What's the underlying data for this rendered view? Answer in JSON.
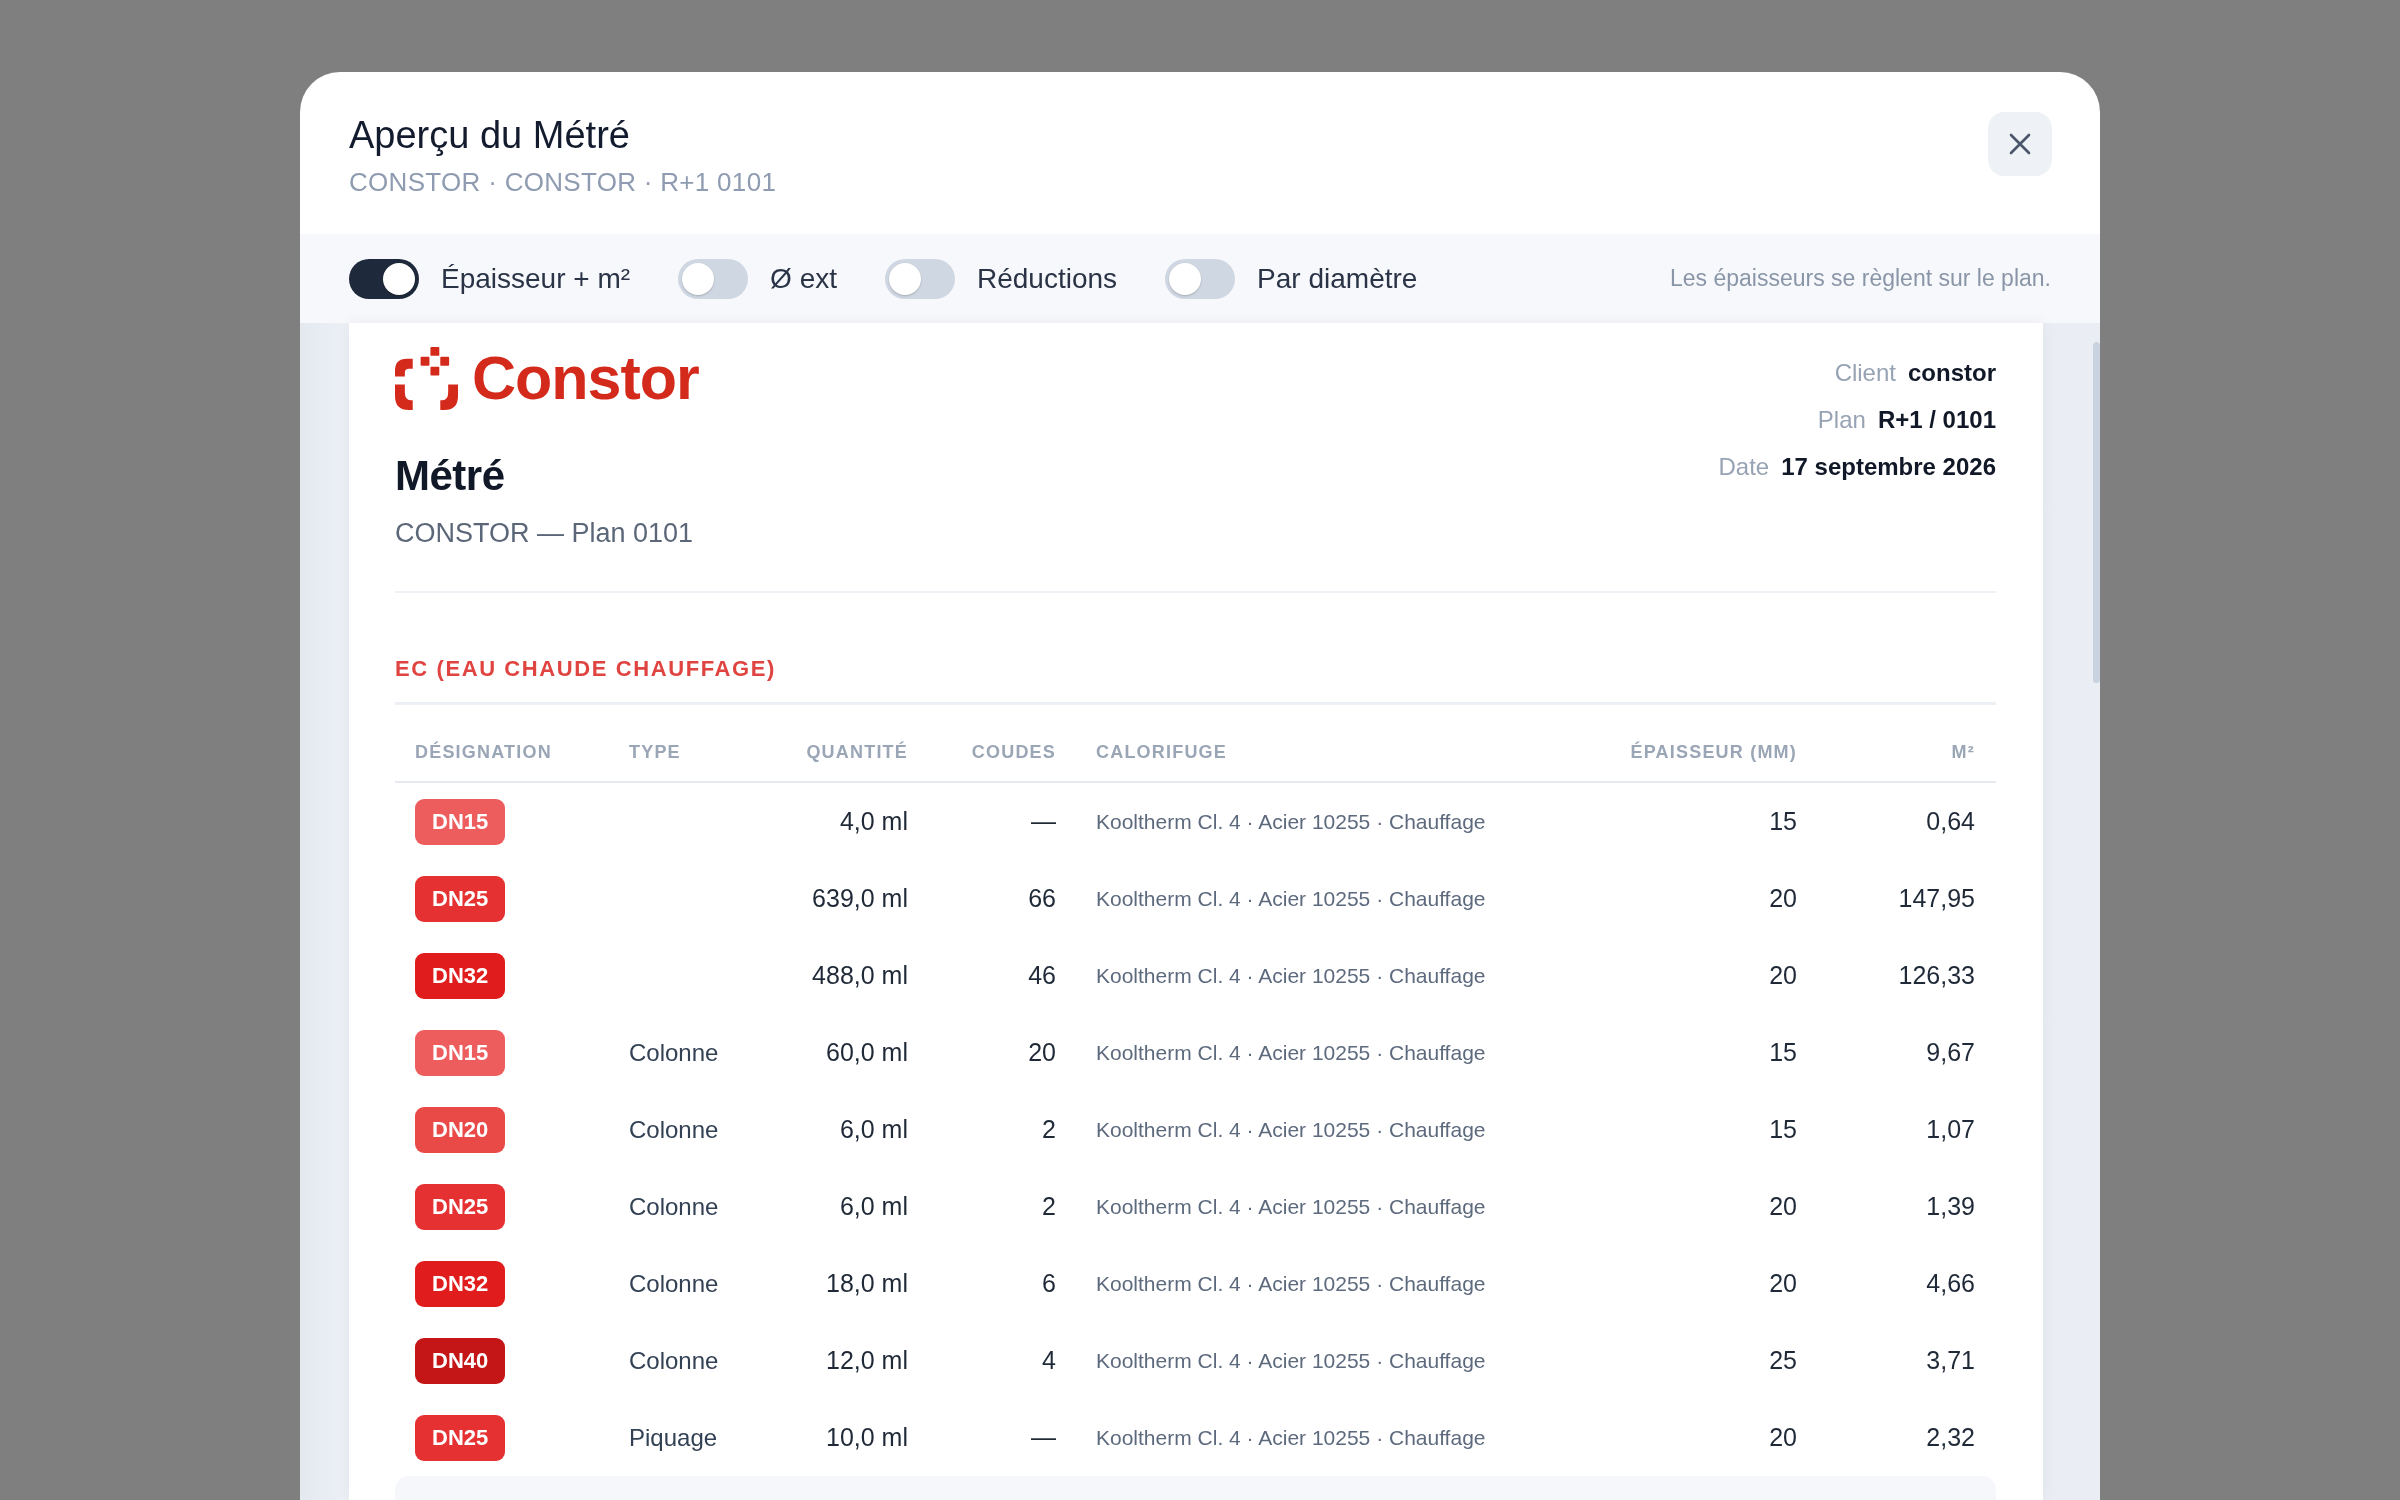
{
  "dialog": {
    "title": "Aperçu du Métré",
    "subtitle": "CONSTOR · CONSTOR · R+1 0101"
  },
  "toggles": [
    {
      "label": "Épaisseur + m²",
      "on": true
    },
    {
      "label": "Ø ext",
      "on": false
    },
    {
      "label": "Réductions",
      "on": false
    },
    {
      "label": "Par diamètre",
      "on": false
    }
  ],
  "toolbar_note": "Les épaisseurs se règlent sur le plan.",
  "document": {
    "logo": "Constor",
    "title": "Métré",
    "subtitle": "CONSTOR — Plan 0101",
    "meta": [
      {
        "label": "Client",
        "value": "constor"
      },
      {
        "label": "Plan",
        "value": "R+1 / 0101"
      },
      {
        "label": "Date",
        "value": "17 septembre 2026"
      }
    ],
    "sections": [
      {
        "heading": "EC (EAU CHAUDE CHAUFFAGE)",
        "columns": [
          "DÉSIGNATION",
          "TYPE",
          "QUANTITÉ",
          "COUDES",
          "CALORIFUGE",
          "ÉPAISSEUR (MM)",
          "M²"
        ],
        "rows": [
          {
            "designation": "DN15",
            "color": "#ee5d5d",
            "quantity": "4,0 ml",
            "elbows": "—",
            "insulation": "Kooltherm Cl. 4 · Acier 10255 · Chauffage",
            "thickness": "15",
            "area": "0,64"
          },
          {
            "designation": "DN25",
            "color": "#e53131",
            "quantity": "639,0 ml",
            "elbows": "66",
            "insulation": "Kooltherm Cl. 4 · Acier 10255 · Chauffage",
            "thickness": "20",
            "area": "147,95"
          },
          {
            "designation": "DN32",
            "color": "#e11c1c",
            "quantity": "488,0 ml",
            "elbows": "46",
            "insulation": "Kooltherm Cl. 4 · Acier 10255 · Chauffage",
            "thickness": "20",
            "area": "126,33"
          },
          {
            "designation": "DN15",
            "color": "#ee5d5d",
            "type": "Colonne",
            "quantity": "60,0 ml",
            "elbows": "20",
            "insulation": "Kooltherm Cl. 4 · Acier 10255 · Chauffage",
            "thickness": "15",
            "area": "9,67"
          },
          {
            "designation": "DN20",
            "color": "#ea4a47",
            "type": "Colonne",
            "quantity": "6,0 ml",
            "elbows": "2",
            "insulation": "Kooltherm Cl. 4 · Acier 10255 · Chauffage",
            "thickness": "15",
            "area": "1,07"
          },
          {
            "designation": "DN25",
            "color": "#e53131",
            "type": "Colonne",
            "quantity": "6,0 ml",
            "elbows": "2",
            "insulation": "Kooltherm Cl. 4 · Acier 10255 · Chauffage",
            "thickness": "20",
            "area": "1,39"
          },
          {
            "designation": "DN32",
            "color": "#e11c1c",
            "type": "Colonne",
            "quantity": "18,0 ml",
            "elbows": "6",
            "insulation": "Kooltherm Cl. 4 · Acier 10255 · Chauffage",
            "thickness": "20",
            "area": "4,66"
          },
          {
            "designation": "DN40",
            "color": "#c41616",
            "type": "Colonne",
            "quantity": "12,0 ml",
            "elbows": "4",
            "insulation": "Kooltherm Cl. 4 · Acier 10255 · Chauffage",
            "thickness": "25",
            "area": "3,71"
          },
          {
            "designation": "DN25",
            "color": "#e53131",
            "type": "Piquage",
            "quantity": "10,0 ml",
            "elbows": "—",
            "insulation": "Kooltherm Cl. 4 · Acier 10255 · Chauffage",
            "thickness": "20",
            "area": "2,32"
          }
        ]
      }
    ]
  }
}
